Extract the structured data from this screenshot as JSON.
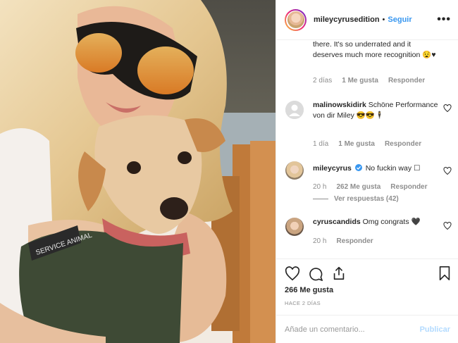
{
  "post": {
    "username": "mileycyrusedition",
    "follow_label": "Seguir",
    "separator": "•",
    "more": "•••"
  },
  "comments": [
    {
      "text": "there. It's so underrated and it deserves much more recognition 😧♥",
      "time": "2 días",
      "likes": "1 Me gusta",
      "reply": "Responder"
    },
    {
      "username": "malinowskidirk",
      "text": "Schöne Performance von dir Miley 😎😎🕴",
      "time": "1 día",
      "likes": "1 Me gusta",
      "reply": "Responder"
    },
    {
      "username": "mileycyrus",
      "text": "No fuckin way ☐",
      "time": "20 h",
      "likes": "262 Me gusta",
      "reply": "Responder",
      "view_replies": "Ver respuestas (42)",
      "verified": true
    },
    {
      "username": "cyruscandids",
      "text": "Omg congrats 🖤",
      "time": "20 h",
      "reply": "Responder"
    }
  ],
  "footer": {
    "likes": "266 Me gusta",
    "posted": "HACE 2 DÍAS",
    "comment_placeholder": "Añade un comentario...",
    "publish": "Publicar"
  },
  "colors": {
    "accent": "#3897f0",
    "muted": "#8e8e8e"
  }
}
